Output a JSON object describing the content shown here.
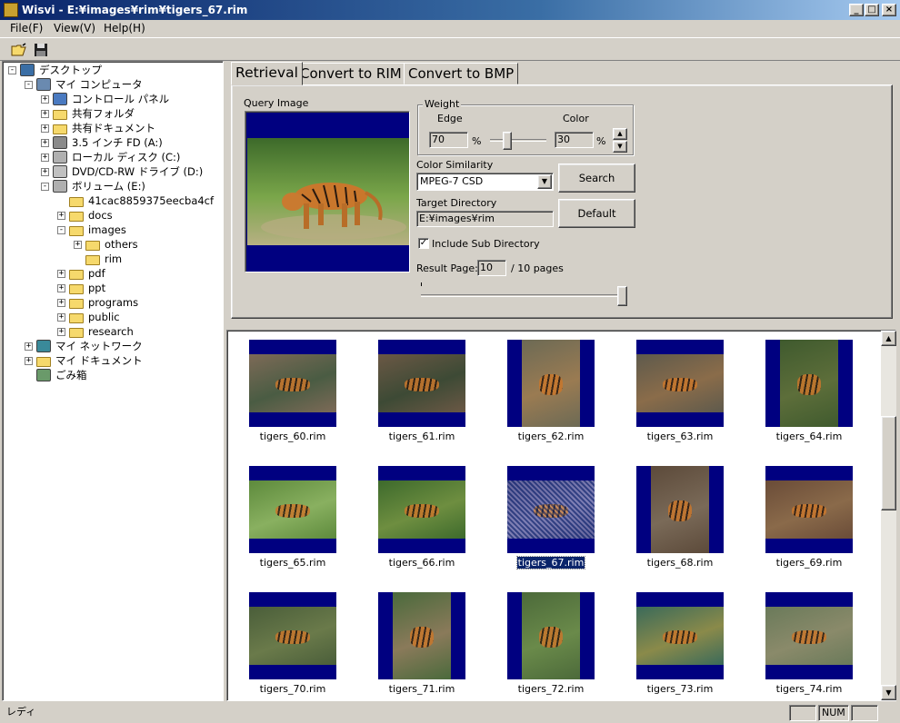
{
  "window": {
    "title": "Wisvi - E:¥images¥rim¥tigers_67.rim",
    "btn_min": "_",
    "btn_max": "□",
    "btn_close": "×"
  },
  "menu": [
    "File(F)",
    "View(V)",
    "Help(H)"
  ],
  "toolbar": {
    "open_icon": "open-folder-icon",
    "save_icon": "save-disk-icon"
  },
  "tree": [
    {
      "label": "デスクトップ",
      "level": 0,
      "exp": "-",
      "icon": "desktop"
    },
    {
      "label": "マイ コンピュータ",
      "level": 1,
      "exp": "-",
      "icon": "computer"
    },
    {
      "label": "コントロール パネル",
      "level": 2,
      "exp": "+",
      "icon": "control"
    },
    {
      "label": "共有フォルダ",
      "level": 2,
      "exp": "+",
      "icon": "shared"
    },
    {
      "label": "共有ドキュメント",
      "level": 2,
      "exp": "+",
      "icon": "folder"
    },
    {
      "label": "3.5 インチ FD (A:)",
      "level": 2,
      "exp": "+",
      "icon": "floppy"
    },
    {
      "label": "ローカル ディスク (C:)",
      "level": 2,
      "exp": "+",
      "icon": "drive"
    },
    {
      "label": "DVD/CD-RW ドライブ (D:)",
      "level": 2,
      "exp": "+",
      "icon": "cd"
    },
    {
      "label": "ボリューム (E:)",
      "level": 2,
      "exp": "-",
      "icon": "drive"
    },
    {
      "label": "41cac8859375eecba4cf",
      "level": 3,
      "exp": "",
      "icon": "folder"
    },
    {
      "label": "docs",
      "level": 3,
      "exp": "+",
      "icon": "folder"
    },
    {
      "label": "images",
      "level": 3,
      "exp": "-",
      "icon": "folder"
    },
    {
      "label": "others",
      "level": 4,
      "exp": "+",
      "icon": "folder"
    },
    {
      "label": "rim",
      "level": 4,
      "exp": "",
      "icon": "folder"
    },
    {
      "label": "pdf",
      "level": 3,
      "exp": "+",
      "icon": "folder"
    },
    {
      "label": "ppt",
      "level": 3,
      "exp": "+",
      "icon": "folder"
    },
    {
      "label": "programs",
      "level": 3,
      "exp": "+",
      "icon": "folder"
    },
    {
      "label": "public",
      "level": 3,
      "exp": "+",
      "icon": "folder"
    },
    {
      "label": "research",
      "level": 3,
      "exp": "+",
      "icon": "folder"
    },
    {
      "label": "マイ ネットワーク",
      "level": 1,
      "exp": "+",
      "icon": "network"
    },
    {
      "label": "マイ ドキュメント",
      "level": 1,
      "exp": "+",
      "icon": "mydocs"
    },
    {
      "label": "ごみ箱",
      "level": 1,
      "exp": "",
      "icon": "trash"
    }
  ],
  "tabs": [
    "Retrieval",
    "Convert to RIM",
    "Convert to BMP"
  ],
  "retrieval": {
    "query_image_label": "Query Image",
    "weight_label": "Weight",
    "edge_label": "Edge",
    "color_label": "Color",
    "edge_value": "70",
    "color_value": "30",
    "percent": "%",
    "edge_weight_fraction": 0.7,
    "similarity_label": "Color Similarity",
    "similarity_value": "MPEG-7 CSD",
    "search_button": "Search",
    "target_dir_label": "Target Directory",
    "target_dir_value": "E:¥images¥rim",
    "default_button": "Default",
    "include_sub_label": "Include Sub Directory",
    "include_sub_checked": true,
    "result_page_label": "Result Page:",
    "result_page_value": "10",
    "result_page_suffix": "/ 10 pages",
    "result_page_fraction": 1.0
  },
  "results": [
    {
      "name": "tigers_60.rim",
      "orient": "landscape",
      "c1": "#7d6a57",
      "c2": "#4a5c43"
    },
    {
      "name": "tigers_61.rim",
      "orient": "landscape",
      "c1": "#6b5845",
      "c2": "#3d4a35"
    },
    {
      "name": "tigers_62.rim",
      "orient": "portrait",
      "c1": "#6c6a55",
      "c2": "#9a7b52"
    },
    {
      "name": "tigers_63.rim",
      "orient": "landscape",
      "c1": "#5e5a4c",
      "c2": "#8a6c4a"
    },
    {
      "name": "tigers_64.rim",
      "orient": "portrait",
      "c1": "#3f5a2e",
      "c2": "#5d6e3a"
    },
    {
      "name": "tigers_65.rim",
      "orient": "landscape",
      "c1": "#5d8a3c",
      "c2": "#89b060"
    },
    {
      "name": "tigers_66.rim",
      "orient": "landscape",
      "c1": "#3d6a2c",
      "c2": "#6e8e40"
    },
    {
      "name": "tigers_67.rim",
      "orient": "landscape",
      "c1": "#4a4a8a",
      "c2": "#6a6aa8"
    },
    {
      "name": "tigers_68.rim",
      "orient": "portrait",
      "c1": "#5c4a3a",
      "c2": "#7a6a58"
    },
    {
      "name": "tigers_69.rim",
      "orient": "landscape",
      "c1": "#6a4c38",
      "c2": "#8a6a4a"
    },
    {
      "name": "tigers_70.rim",
      "orient": "landscape",
      "c1": "#4a5e3a",
      "c2": "#6a7a4a"
    },
    {
      "name": "tigers_71.rim",
      "orient": "portrait",
      "c1": "#4a6a3c",
      "c2": "#8a7a5a"
    },
    {
      "name": "tigers_72.rim",
      "orient": "portrait",
      "c1": "#4c6a3a",
      "c2": "#6a8a4a"
    },
    {
      "name": "tigers_73.rim",
      "orient": "landscape",
      "c1": "#3a6a5a",
      "c2": "#8a8a4a"
    },
    {
      "name": "tigers_74.rim",
      "orient": "landscape",
      "c1": "#6a7a5a",
      "c2": "#8a8a6a"
    }
  ],
  "selected_result": "tigers_67.rim",
  "status": {
    "text": "レディ",
    "num": "NUM"
  }
}
